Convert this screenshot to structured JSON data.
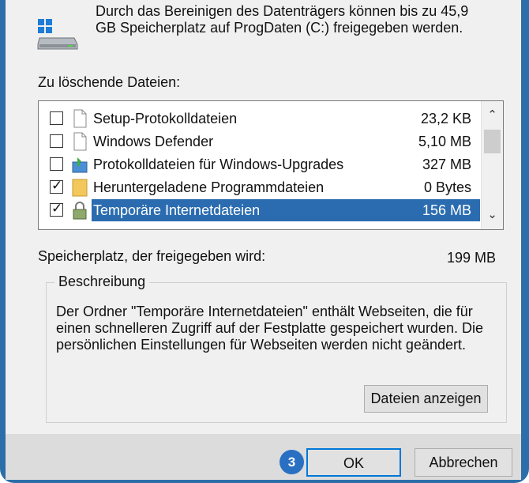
{
  "header": {
    "text": "Durch das Bereinigen des Datenträgers können bis zu 45,9 GB Speicherplatz auf ProgDaten (C:) freigegeben werden."
  },
  "list": {
    "label": "Zu löschende Dateien:",
    "rows": [
      {
        "name": "Setup-Protokolldateien",
        "size": "23,2 KB",
        "checked": false,
        "icon": "document-icon"
      },
      {
        "name": "Windows Defender",
        "size": "5,10 MB",
        "checked": false,
        "icon": "document-icon"
      },
      {
        "name": "Protokolldateien für Windows-Upgrades",
        "size": "327 MB",
        "checked": false,
        "icon": "upgrade-log-icon"
      },
      {
        "name": "Heruntergeladene Programmdateien",
        "size": "0 Bytes",
        "checked": true,
        "icon": "folder-icon"
      },
      {
        "name": "Temporäre Internetdateien",
        "size": "156 MB",
        "checked": true,
        "icon": "lock-icon",
        "selected": true
      }
    ],
    "check_glyph": "✓",
    "scroll_up": "⌃",
    "scroll_down": "⌄"
  },
  "freed": {
    "label": "Speicherplatz, der freigegeben wird:",
    "value": "199 MB"
  },
  "description": {
    "legend": "Beschreibung",
    "text": "Der Ordner \"Temporäre Internetdateien\" enthält Webseiten, die für einen schnelleren Zugriff auf der Festplatte gespeichert wurden. Die persönlichen Einstellungen für Webseiten werden nicht geändert.",
    "show_files_button": "Dateien anzeigen"
  },
  "buttons": {
    "ok": "OK",
    "cancel": "Abbrechen"
  },
  "callout": "3",
  "colors": {
    "accent": "#2c6ea9",
    "selection": "#2b6cb0",
    "callout": "#2a70c2"
  }
}
